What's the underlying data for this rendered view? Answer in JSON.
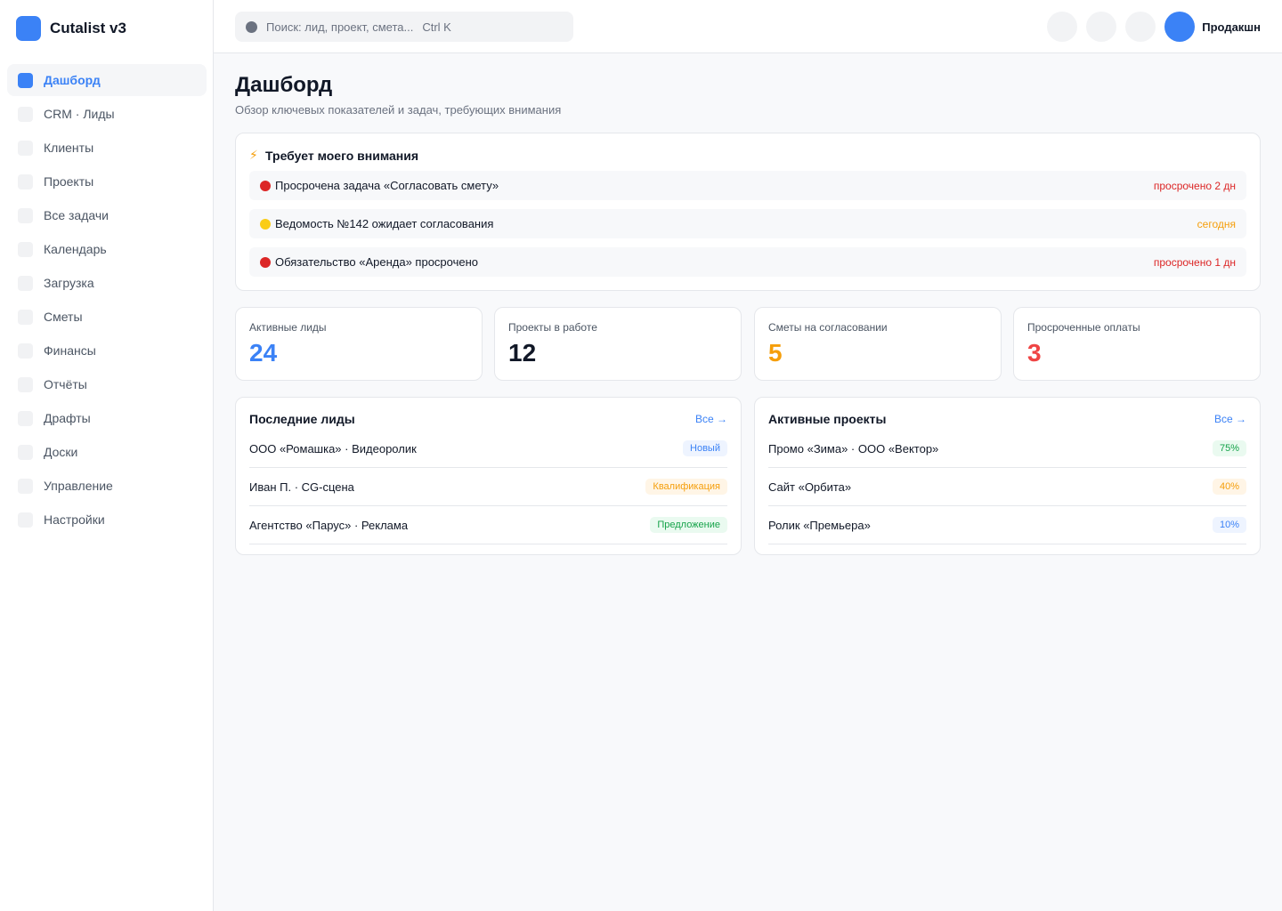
{
  "app": {
    "name": "Cutalist v3"
  },
  "sidebar": {
    "items": [
      {
        "label": "Дашборд",
        "active": true
      },
      {
        "label": "CRM · Лиды"
      },
      {
        "label": "Клиенты"
      },
      {
        "label": "Проекты"
      },
      {
        "label": "Все задачи"
      },
      {
        "label": "Календарь"
      },
      {
        "label": "Загрузка"
      },
      {
        "label": "Сметы"
      },
      {
        "label": "Финансы"
      },
      {
        "label": "Отчёты"
      },
      {
        "label": "Драфты"
      },
      {
        "label": "Доски"
      },
      {
        "label": "Управление"
      },
      {
        "label": "Настройки"
      }
    ]
  },
  "topbar": {
    "search": {
      "placeholder": "Поиск: лид, проект, смета...",
      "shortcut": "Ctrl K"
    },
    "workspace": "Продакшн"
  },
  "page": {
    "title": "Дашборд",
    "subtitle": "Обзор ключевых показателей и задач, требующих внимания"
  },
  "attention": {
    "icon": "⚡",
    "title": "Требует моего внимания",
    "items": [
      {
        "text": "Просрочена задача «Согласовать смету»",
        "status": "просрочено 2 дн",
        "dot_color": "#dc2626",
        "status_color": "#dc2626"
      },
      {
        "text": "Ведомость №142 ожидает согласования",
        "status": "сегодня",
        "dot_color": "#facc15",
        "status_color": "#f59e0b"
      },
      {
        "text": "Обязательство «Аренда» просрочено",
        "status": "просрочено 1 дн",
        "dot_color": "#dc2626",
        "status_color": "#dc2626"
      }
    ]
  },
  "kpis": [
    {
      "label": "Активные лиды",
      "value": "24",
      "color": "#3b82f6"
    },
    {
      "label": "Проекты в работе",
      "value": "12",
      "color": "#111827"
    },
    {
      "label": "Сметы на согласовании",
      "value": "5",
      "color": "#f59e0b"
    },
    {
      "label": "Просроченные оплаты",
      "value": "3",
      "color": "#ef4444"
    }
  ],
  "recent_leads": {
    "title": "Последние лиды",
    "all_label": "Все →",
    "rows": [
      {
        "text": "ООО «Ромашка» · Видеоролик",
        "badge": "Новый",
        "badge_color": "#3b82f6",
        "badge_bg": "#eef4ff"
      },
      {
        "text": "Иван П. · CG-сцена",
        "badge": "Квалификация",
        "badge_color": "#f59e0b",
        "badge_bg": "#fff5e6"
      },
      {
        "text": "Агентство «Парус» · Реклама",
        "badge": "Предложение",
        "badge_color": "#16a34a",
        "badge_bg": "#eafaf0"
      }
    ]
  },
  "active_projects": {
    "title": "Активные проекты",
    "all_label": "Все →",
    "rows": [
      {
        "text": "Промо «Зима» · ООО «Вектор»",
        "badge": "75%",
        "badge_color": "#16a34a",
        "badge_bg": "#eafaf0"
      },
      {
        "text": "Сайт «Орбита»",
        "badge": "40%",
        "badge_color": "#f59e0b",
        "badge_bg": "#fff5e6"
      },
      {
        "text": "Ролик «Премьера»",
        "badge": "10%",
        "badge_color": "#3b82f6",
        "badge_bg": "#eef4ff"
      }
    ]
  }
}
